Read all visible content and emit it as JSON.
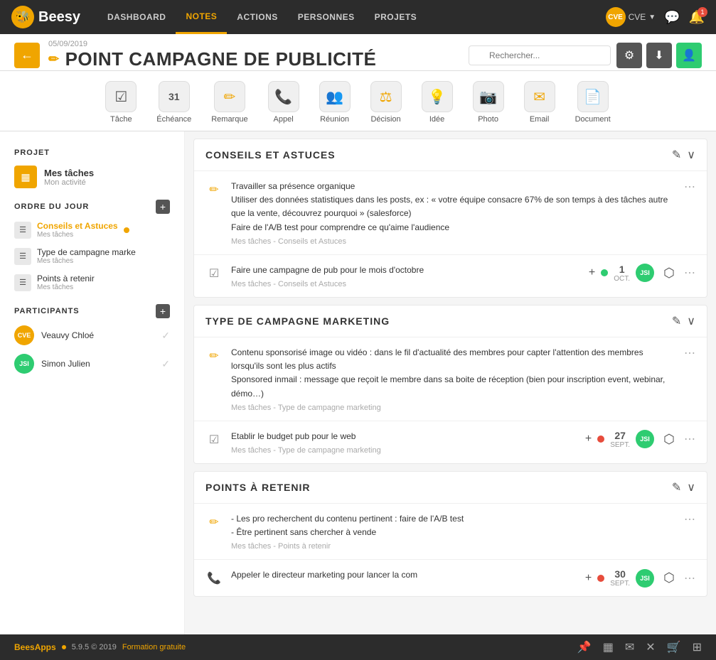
{
  "nav": {
    "logo": "Beesy",
    "links": [
      "DASHBOARD",
      "NOTES",
      "ACTIONS",
      "PERSONNES",
      "PROJETS"
    ],
    "active_link": "NOTES",
    "user": "CVE",
    "notification_count": "1"
  },
  "header": {
    "date": "05/09/2019",
    "title": "POINT CAMPAGNE DE PUBLICITÉ",
    "search_placeholder": "Rechercher...",
    "back_label": "←",
    "pencil": "✏"
  },
  "icon_toolbar": [
    {
      "icon": "☑",
      "label": "Tâche"
    },
    {
      "icon": "31",
      "label": "Échéance"
    },
    {
      "icon": "✏",
      "label": "Remarque"
    },
    {
      "icon": "📞",
      "label": "Appel"
    },
    {
      "icon": "👥",
      "label": "Réunion"
    },
    {
      "icon": "⚖",
      "label": "Décision"
    },
    {
      "icon": "💡",
      "label": "Idée"
    },
    {
      "icon": "📷",
      "label": "Photo"
    },
    {
      "icon": "✉",
      "label": "Email"
    },
    {
      "icon": "📄",
      "label": "Document"
    }
  ],
  "sidebar": {
    "project_section": "PROJET",
    "project_name": "Mes tâches",
    "project_sub": "Mon activité",
    "agenda_section": "ORDRE DU JOUR",
    "agenda_items": [
      {
        "name": "Conseils et Astuces",
        "sub": "Mes tâches",
        "active": true,
        "has_dot": true
      },
      {
        "name": "Type de campagne marke",
        "sub": "Mes tâches",
        "active": false,
        "has_dot": false
      },
      {
        "name": "Points à retenir",
        "sub": "Mes tâches",
        "active": false,
        "has_dot": false
      }
    ],
    "participants_section": "PARTICIPANTS",
    "participants": [
      {
        "initials": "CVE",
        "name": "Veauvy Chloé",
        "color": "#f0a500"
      },
      {
        "initials": "JSI",
        "name": "Simon Julien",
        "color": "#2ecc71"
      }
    ]
  },
  "sections": [
    {
      "id": "conseils",
      "title": "CONSEILS ET ASTUCES",
      "items": [
        {
          "icon_type": "pencil",
          "text": "Travailler sa présence organique\nUtiliser des données statistiques dans les posts, ex : « votre équipe consacre 67% de son temps à des tâches autre que la vente, découvrez pourquoi » (salesforce)\nFaire de l'A/B test pour comprendre ce qu'aime l'audience",
          "meta": "Mes tâches - Conseils et Astuces",
          "has_task": false
        },
        {
          "icon_type": "task",
          "text": "Faire une campagne de pub pour le mois d'octobre",
          "meta": "Mes tâches - Conseils et Astuces",
          "has_task": true,
          "day": "1",
          "month": "OCT.",
          "user_initials": "JSI",
          "dot_color": "green"
        }
      ]
    },
    {
      "id": "type",
      "title": "TYPE DE CAMPAGNE MARKETING",
      "items": [
        {
          "icon_type": "pencil",
          "text": "Contenu sponsorisé image ou vidéo : dans le fil d'actualité des membres pour capter l'attention des membres lorsqu'ils sont les plus actifs\nSponsored inmail : message que reçoit le membre dans sa boite de réception (bien pour inscription event, webinar, démo…)",
          "meta": "Mes tâches - Type de campagne marketing",
          "has_task": false
        },
        {
          "icon_type": "task",
          "text": "Etablir le budget pub pour le web",
          "meta": "Mes tâches - Type de campagne marketing",
          "has_task": true,
          "day": "27",
          "month": "SEPT.",
          "user_initials": "JSI",
          "dot_color": "red"
        }
      ]
    },
    {
      "id": "points",
      "title": "POINTS À RETENIR",
      "items": [
        {
          "icon_type": "pencil",
          "text": "- Les pro recherchent du contenu pertinent : faire de l'A/B test\n- Être pertinent sans chercher à vende",
          "meta": "Mes tâches - Points à retenir",
          "has_task": false
        },
        {
          "icon_type": "phone",
          "text": "Appeler le directeur marketing pour lancer la com",
          "meta": "",
          "has_task": true,
          "day": "30",
          "month": "SEPT.",
          "user_initials": "JSI",
          "dot_color": "red"
        }
      ]
    }
  ],
  "footer": {
    "brand": "BeesApps",
    "version": "5.9.5 © 2019",
    "training": "Formation gratuite"
  }
}
